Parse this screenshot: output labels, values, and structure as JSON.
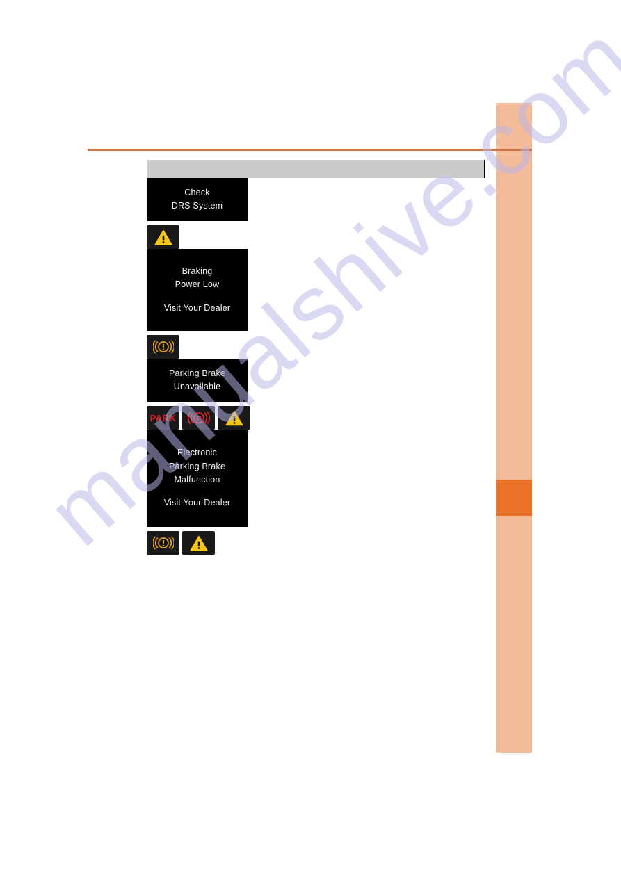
{
  "page": {
    "background_color": "#ffffff",
    "watermark_text": "manualshive.com",
    "watermark_color": "#b9b7e8"
  },
  "edge_index": {
    "band_color": "#f4bb98",
    "tab_color": "#e97128",
    "rule_color": "#c8764a"
  },
  "table": {
    "header": {
      "col_left_label": "",
      "col_right_label": ""
    },
    "rows": [
      {
        "id": "check-drs-system",
        "display_lines": [
          "Check",
          "DRS System"
        ],
        "display_gap_before_index": null,
        "description": "",
        "indicators": [
          {
            "name": "master-warning-triangle-icon",
            "type": "warning-triangle",
            "color": "#f5c518"
          }
        ]
      },
      {
        "id": "braking-power-low",
        "display_lines": [
          "Braking",
          "Power Low",
          "Visit Your Dealer"
        ],
        "display_gap_before_index": 2,
        "description": "",
        "indicators": [
          {
            "name": "brake-system-warning-icon",
            "type": "brake-warning",
            "color": "#e8a317"
          }
        ]
      },
      {
        "id": "parking-brake-unavailable",
        "display_lines": [
          "Parking Brake",
          "Unavailable"
        ],
        "display_gap_before_index": null,
        "description": "",
        "indicators": [
          {
            "name": "park-text-indicator-icon",
            "type": "park-text",
            "label": "PARK",
            "color": "#e02020"
          },
          {
            "name": "electric-parking-brake-icon",
            "type": "epb-p",
            "color": "#e02020"
          },
          {
            "name": "master-warning-triangle-icon",
            "type": "warning-triangle",
            "color": "#f5c518"
          }
        ]
      },
      {
        "id": "electronic-parking-brake-malfunction",
        "display_lines": [
          "Electronic",
          "Parking Brake",
          "Malfunction",
          "Visit Your Dealer"
        ],
        "display_gap_before_index": 3,
        "description": "",
        "indicators": [
          {
            "name": "brake-system-warning-icon",
            "type": "brake-warning",
            "color": "#e8a317"
          },
          {
            "name": "master-warning-triangle-icon",
            "type": "warning-triangle",
            "color": "#f5c518"
          }
        ]
      }
    ]
  }
}
